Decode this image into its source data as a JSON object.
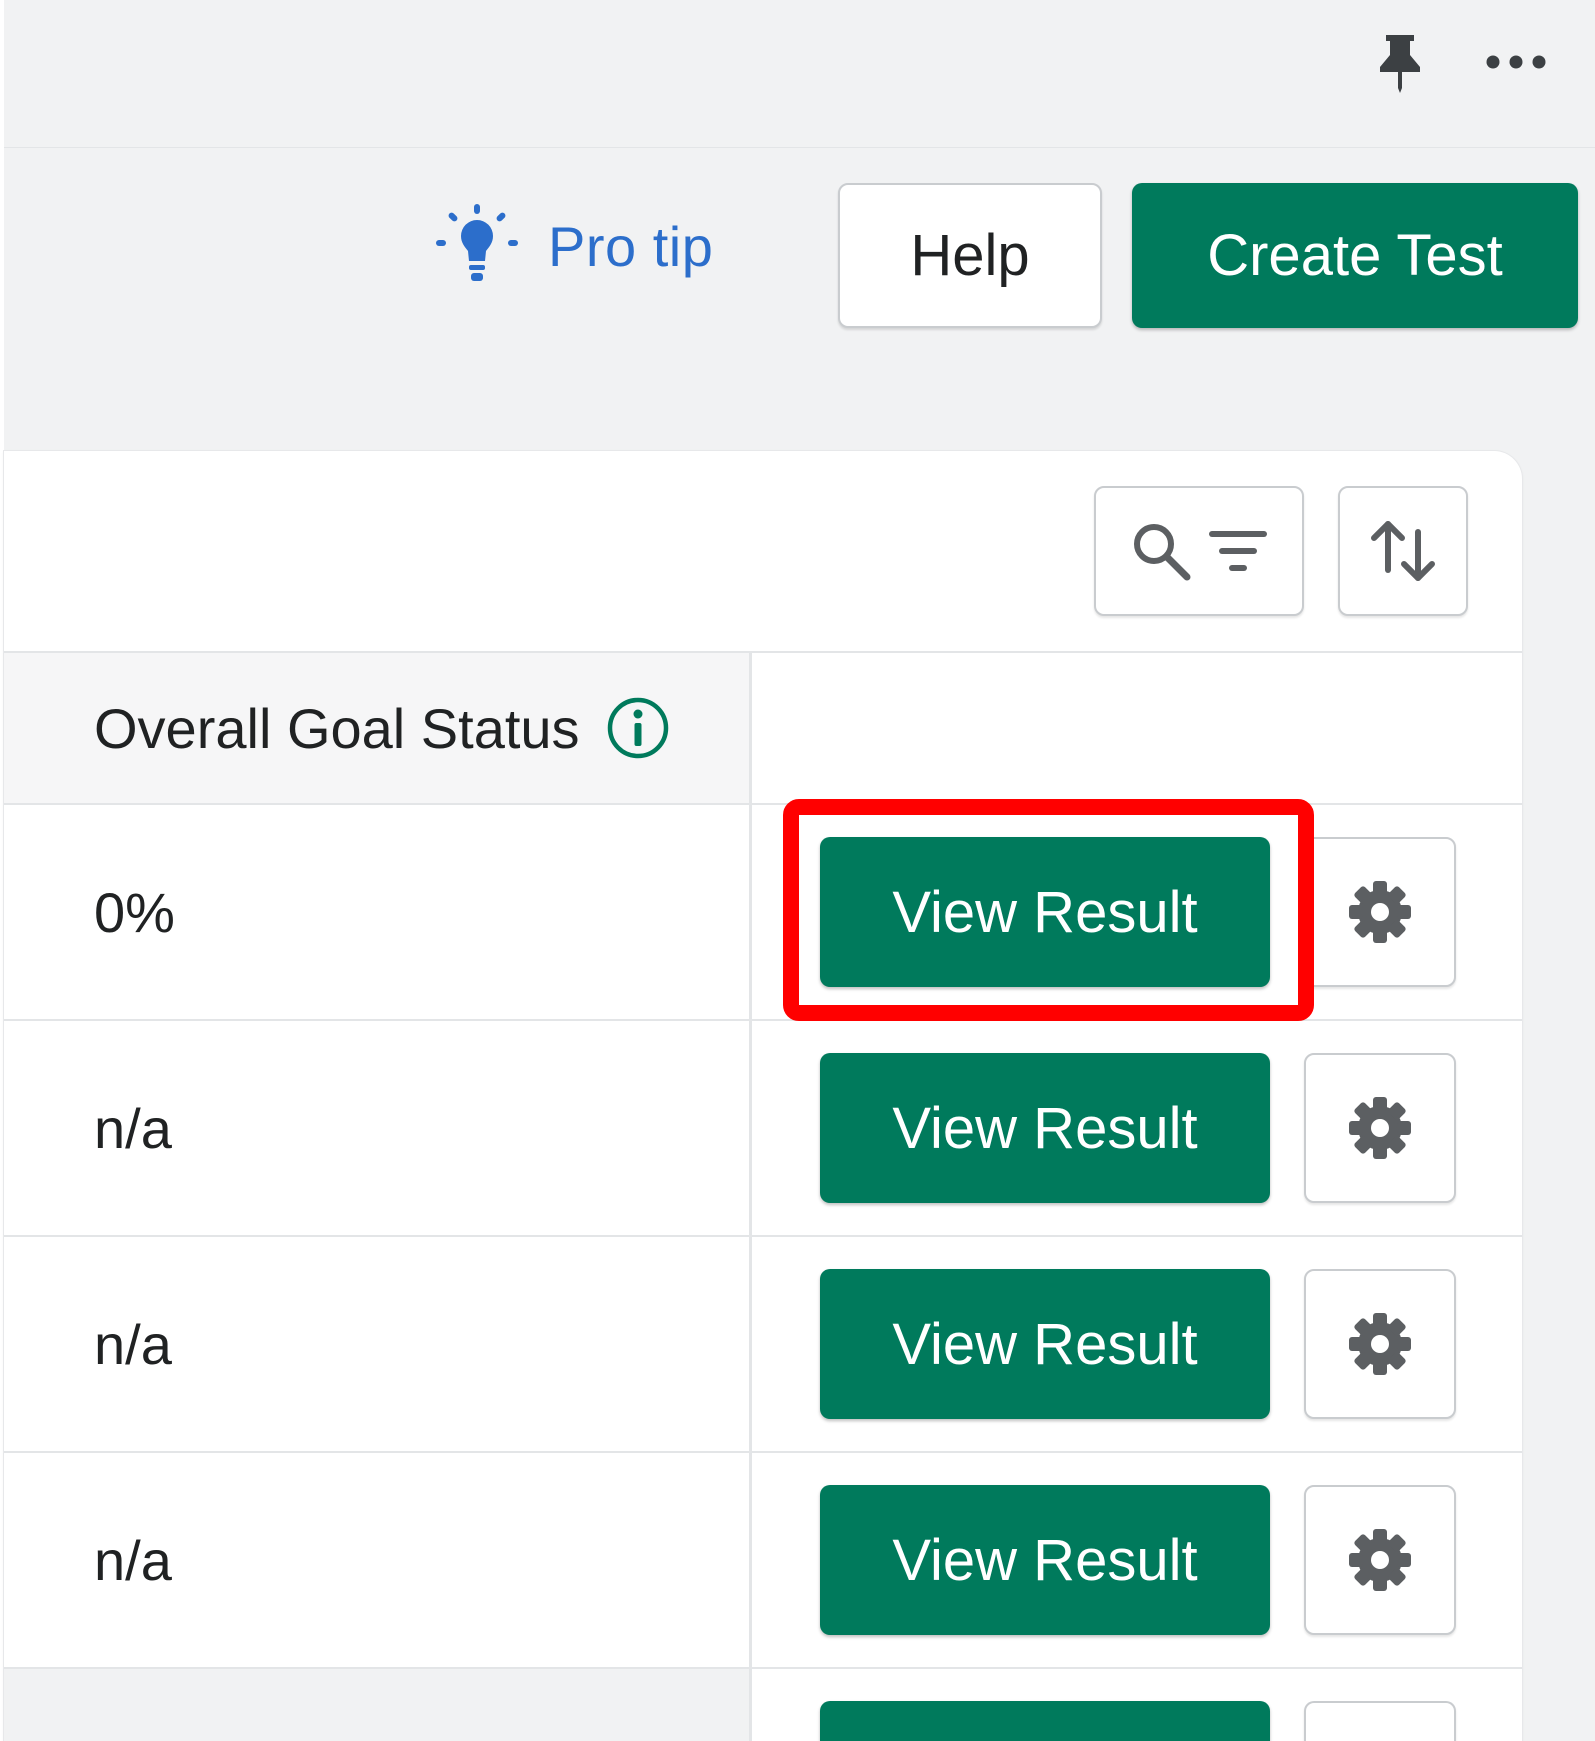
{
  "header": {
    "pro_tip_label": "Pro tip",
    "help_label": "Help",
    "create_test_label": "Create Test"
  },
  "table": {
    "column_header": "Overall Goal Status",
    "rows": [
      {
        "status": "0%",
        "action_label": "View Result"
      },
      {
        "status": "n/a",
        "action_label": "View Result"
      },
      {
        "status": "n/a",
        "action_label": "View Result"
      },
      {
        "status": "n/a",
        "action_label": "View Result"
      }
    ]
  },
  "colors": {
    "primary_green": "#007a5c",
    "link_blue": "#2c6ecb",
    "highlight_red": "#ff0000"
  },
  "icons": [
    "pin-icon",
    "more-icon",
    "lightbulb-icon",
    "search-icon",
    "filter-icon",
    "sort-icon",
    "info-icon",
    "gear-icon"
  ]
}
